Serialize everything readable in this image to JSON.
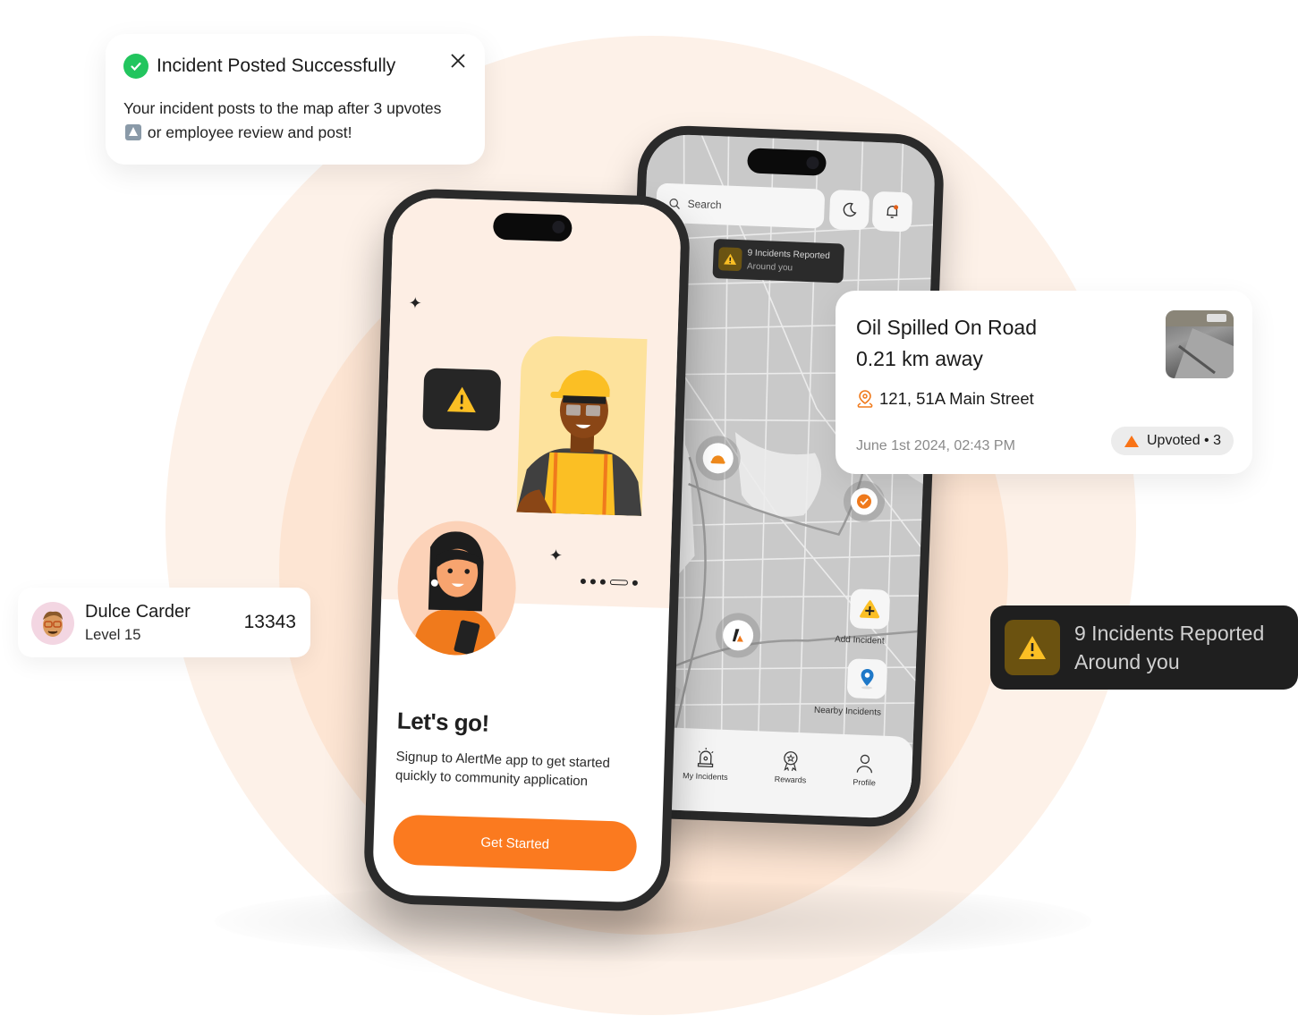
{
  "toast": {
    "title": "Incident Posted Successfully",
    "body_before": "Your incident posts to the map after 3 upvotes",
    "body_after": "or employee review and post!",
    "icon": "check-circle-icon",
    "close_icon": "close-icon"
  },
  "map_screen": {
    "search_placeholder": "Search",
    "alert_line1": "9 Incidents Reported",
    "alert_line2": "Around you",
    "actions": [
      {
        "label": "Add Incident",
        "icon": "add-incident-icon"
      },
      {
        "label": "Nearby Incidents",
        "icon": "location-pin-icon"
      }
    ],
    "nav": [
      {
        "label": "My Incidents",
        "icon": "siren-icon"
      },
      {
        "label": "Rewards",
        "icon": "badge-icon"
      },
      {
        "label": "Profile",
        "icon": "profile-icon"
      }
    ]
  },
  "onboarding": {
    "title": "Let's go!",
    "subtitle": "Signup to AlertMe app to get started quickly to community application",
    "cta": "Get Started",
    "page_count": 5,
    "active_page": 4
  },
  "incident_card": {
    "title": "Oil Spilled On Road",
    "distance": "0.21 km away",
    "address": "121, 51A Main Street",
    "datetime": "June 1st 2024, 02:43 PM",
    "upvote_label": "Upvoted • 3"
  },
  "user_card": {
    "name": "Dulce Carder",
    "level": "Level 15",
    "score": "13343"
  },
  "dark_alert": {
    "line1": "9 Incidents Reported",
    "line2": "Around you"
  },
  "colors": {
    "accent": "#fb7a1f",
    "success": "#22c55e",
    "warning": "#fbbf24",
    "background_peach": "#fdf1e8",
    "dark_card": "#1f1f1f"
  }
}
